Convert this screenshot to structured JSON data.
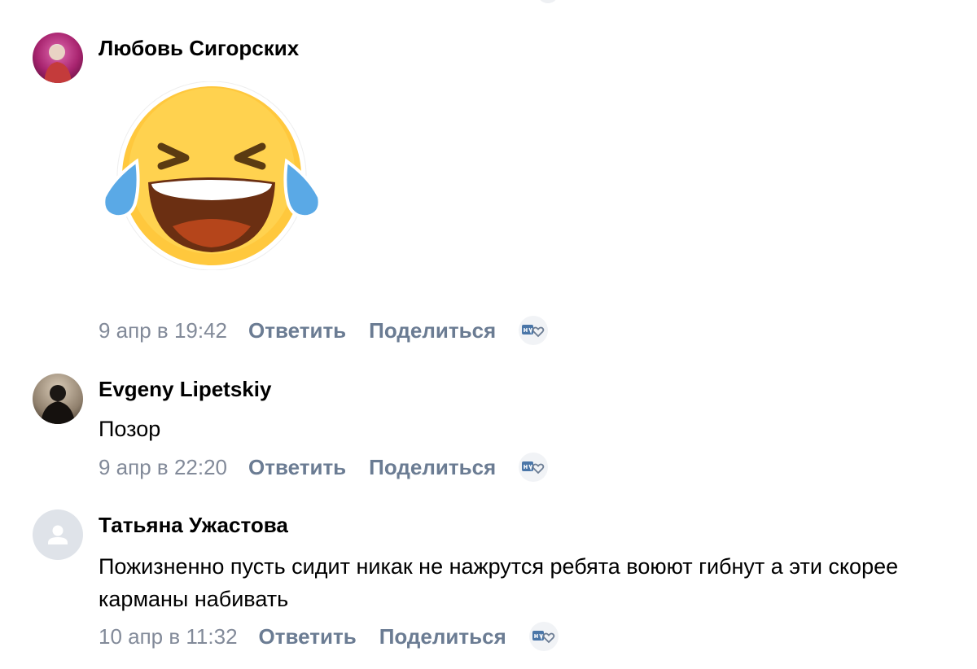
{
  "comments": [
    {
      "author": "Любовь Сигорских",
      "avatar": "user-photo",
      "sticker": "laughing-tears-emoji",
      "date": "9 апр в 19:42",
      "reply_label": "Ответить",
      "share_label": "Поделиться",
      "like_icon": "like-icon"
    },
    {
      "author": "Evgeny Lipetskiy",
      "avatar": "user-photo",
      "text": "Позор",
      "date": "9 апр в 22:20",
      "reply_label": "Ответить",
      "share_label": "Поделиться",
      "like_icon": "like-icon"
    },
    {
      "author": "Татьяна Ужастова",
      "avatar": "default-user-icon",
      "text": "Пожизненно пусть сидит никак не нажрутся ребята воюют гибнут а эти скорее карманы набивать",
      "date": "10 апр в 11:32",
      "reply_label": "Ответить",
      "share_label": "Поделиться",
      "like_icon": "like-icon"
    }
  ],
  "colors": {
    "meta_date": "#828a99",
    "meta_action": "#6b7c93",
    "like_bg": "#f1f3f6",
    "default_avatar_bg": "#dfe3e9",
    "emoji_face": "#ffc83d",
    "emoji_tear": "#5aa9e6"
  }
}
